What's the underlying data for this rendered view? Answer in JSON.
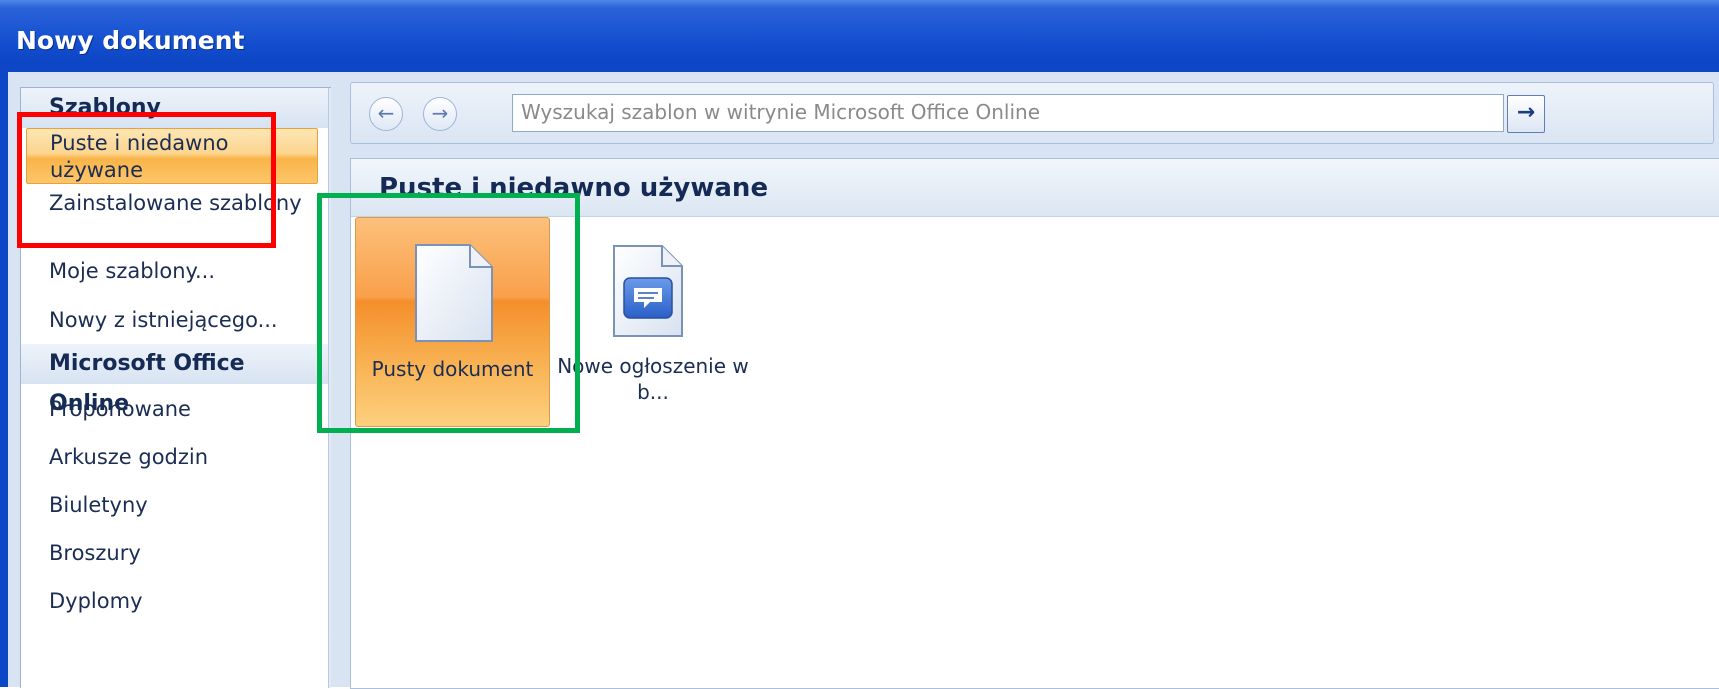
{
  "window": {
    "title": "Nowy dokument"
  },
  "sidebar": {
    "section_templates": "Szablony",
    "items_templates": [
      {
        "label": "Puste i niedawno używane",
        "selected": true
      },
      {
        "label": "Zainstalowane szablony",
        "selected": false
      },
      {
        "label": "Moje szablony...",
        "selected": false
      },
      {
        "label": "Nowy z istniejącego...",
        "selected": false
      }
    ],
    "section_online": "Microsoft Office Online",
    "items_online": [
      {
        "label": "Proponowane"
      },
      {
        "label": "Arkusze godzin"
      },
      {
        "label": "Biuletyny"
      },
      {
        "label": "Broszury"
      },
      {
        "label": "Dyplomy"
      }
    ]
  },
  "toolbar": {
    "back_icon": "arrow-left-icon",
    "forward_icon": "arrow-right-icon",
    "search_placeholder": "Wyszukaj szablon w witrynie Microsoft Office Online",
    "go_icon": "arrow-right-icon"
  },
  "main": {
    "title": "Puste i niedawno używane",
    "templates": [
      {
        "label": "Pusty dokument",
        "icon": "blank-document-icon",
        "selected": true
      },
      {
        "label": "Nowe ogłoszenie w b...",
        "icon": "blog-post-icon",
        "selected": false
      }
    ]
  },
  "highlights": {
    "red_color": "#ff0000",
    "green_color": "#00b050"
  }
}
